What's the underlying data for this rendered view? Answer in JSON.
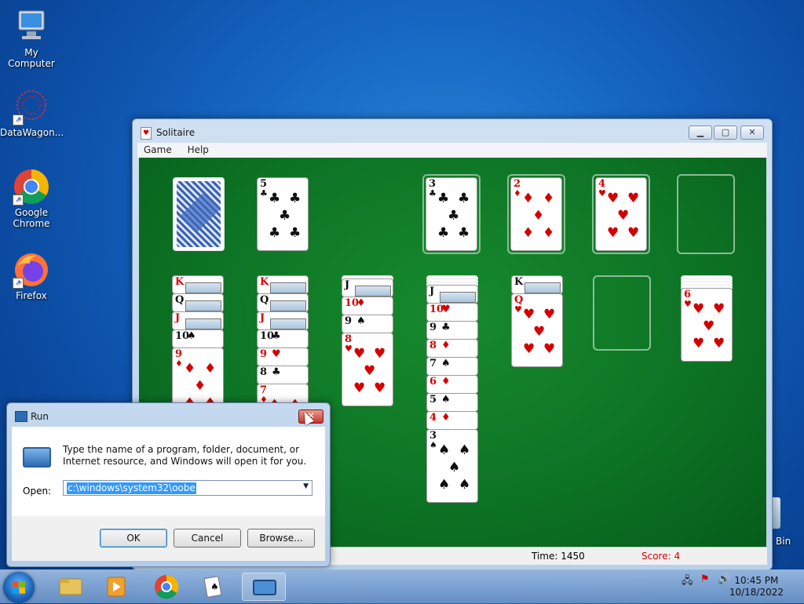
{
  "desktop": {
    "icons": [
      {
        "label": "My Computer",
        "icon": "computer-icon"
      },
      {
        "label": "DataWagon...",
        "icon": "datawagon-icon"
      },
      {
        "label": "Google Chrome",
        "icon": "chrome-icon"
      },
      {
        "label": "Firefox",
        "icon": "firefox-icon"
      }
    ],
    "recycle_label": "Bin"
  },
  "solitaire": {
    "title": "Solitaire",
    "menu": [
      "Game",
      "Help"
    ],
    "status": {
      "time_label": "Time: 1450",
      "score_label": "Score: 4"
    },
    "stock": {
      "type": "card-back"
    },
    "waste": {
      "rank": "5",
      "suit": "♣",
      "color": "black"
    },
    "foundations": [
      {
        "rank": "3",
        "suit": "♣",
        "color": "black"
      },
      {
        "rank": "2",
        "suit": "♦",
        "color": "red"
      },
      {
        "rank": "4",
        "suit": "♥",
        "color": "red"
      },
      {
        "rank": "",
        "suit": "",
        "color": "empty"
      }
    ],
    "tableau": [
      {
        "face_down": 0,
        "cards": [
          {
            "rank": "K",
            "suit": "",
            "color": "red"
          },
          {
            "rank": "Q",
            "suit": "",
            "color": "blk"
          },
          {
            "rank": "J",
            "suit": "",
            "color": "red"
          },
          {
            "rank": "10",
            "suit": "♠",
            "color": "blk"
          },
          {
            "rank": "9",
            "suit": "♦",
            "color": "red"
          }
        ]
      },
      {
        "face_down": 0,
        "cards": [
          {
            "rank": "K",
            "suit": "",
            "color": "red"
          },
          {
            "rank": "Q",
            "suit": "",
            "color": "blk"
          },
          {
            "rank": "J",
            "suit": "",
            "color": "red"
          },
          {
            "rank": "10",
            "suit": "♣",
            "color": "blk"
          },
          {
            "rank": "9",
            "suit": "♥",
            "color": "red"
          },
          {
            "rank": "8",
            "suit": "♣",
            "color": "blk"
          },
          {
            "rank": "7",
            "suit": "♦",
            "color": "red"
          }
        ]
      },
      {
        "face_down": 1,
        "cards": [
          {
            "rank": "J",
            "suit": "",
            "color": "blk"
          },
          {
            "rank": "10",
            "suit": "♦",
            "color": "red"
          },
          {
            "rank": "9",
            "suit": "♠",
            "color": "blk"
          },
          {
            "rank": "8",
            "suit": "♥",
            "color": "red"
          }
        ]
      },
      {
        "face_down": 3,
        "cards": [
          {
            "rank": "J",
            "suit": "",
            "color": "blk"
          },
          {
            "rank": "10",
            "suit": "♥",
            "color": "red"
          },
          {
            "rank": "9",
            "suit": "♣",
            "color": "blk"
          },
          {
            "rank": "8",
            "suit": "♦",
            "color": "red"
          },
          {
            "rank": "7",
            "suit": "♠",
            "color": "blk"
          },
          {
            "rank": "6",
            "suit": "♦",
            "color": "red"
          },
          {
            "rank": "5",
            "suit": "♠",
            "color": "blk"
          },
          {
            "rank": "4",
            "suit": "♦",
            "color": "red"
          },
          {
            "rank": "3",
            "suit": "♠",
            "color": "blk"
          }
        ]
      },
      {
        "face_down": 0,
        "cards": [
          {
            "rank": "K",
            "suit": "",
            "color": "blk"
          },
          {
            "rank": "Q",
            "suit": "♥",
            "color": "red"
          }
        ]
      },
      {
        "face_down": 0,
        "cards": []
      },
      {
        "face_down": 4,
        "cards": [
          {
            "rank": "6",
            "suit": "♥",
            "color": "red"
          }
        ]
      }
    ]
  },
  "run_dialog": {
    "title": "Run",
    "close_label": "✕",
    "description": "Type the name of a program, folder, document, or Internet resource, and Windows will open it for you.",
    "open_label": "Open:",
    "open_value": "c:\\windows\\system32\\oobe",
    "ok_label": "OK",
    "cancel_label": "Cancel",
    "browse_label": "Browse..."
  },
  "taskbar": {
    "items": [
      "explorer-icon",
      "media-player-icon",
      "chrome-icon",
      "solitaire-icon",
      "run-icon"
    ],
    "time": "10:45 PM",
    "date": "10/18/2022"
  }
}
